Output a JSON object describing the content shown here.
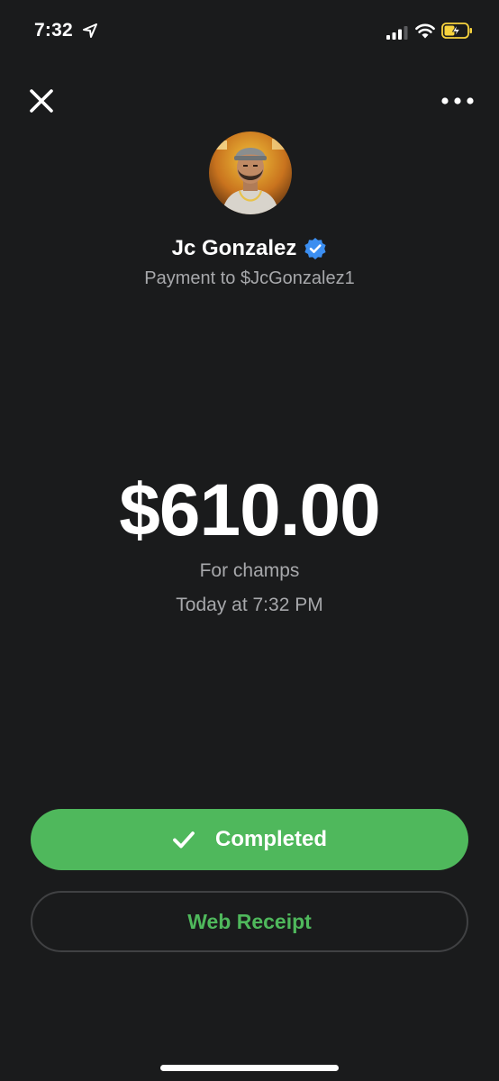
{
  "status_bar": {
    "time": "7:32"
  },
  "header": {
    "close_icon": "close-icon",
    "more_icon": "more-horizontal-icon"
  },
  "recipient": {
    "name": "Jc Gonzalez",
    "verified_icon": "verified-badge-icon",
    "payment_to": "Payment to $JcGonzalez1"
  },
  "payment": {
    "amount": "$610.00",
    "note": "For champs",
    "date": "Today at 7:32 PM"
  },
  "actions": {
    "completed_label": "Completed",
    "receipt_label": "Web Receipt"
  },
  "colors": {
    "background": "#1a1b1c",
    "accent_green": "#4fb85c",
    "secondary_text": "#a7a8ab",
    "verified_blue": "#3b8ef0",
    "battery_charging": "#f7d33e"
  }
}
